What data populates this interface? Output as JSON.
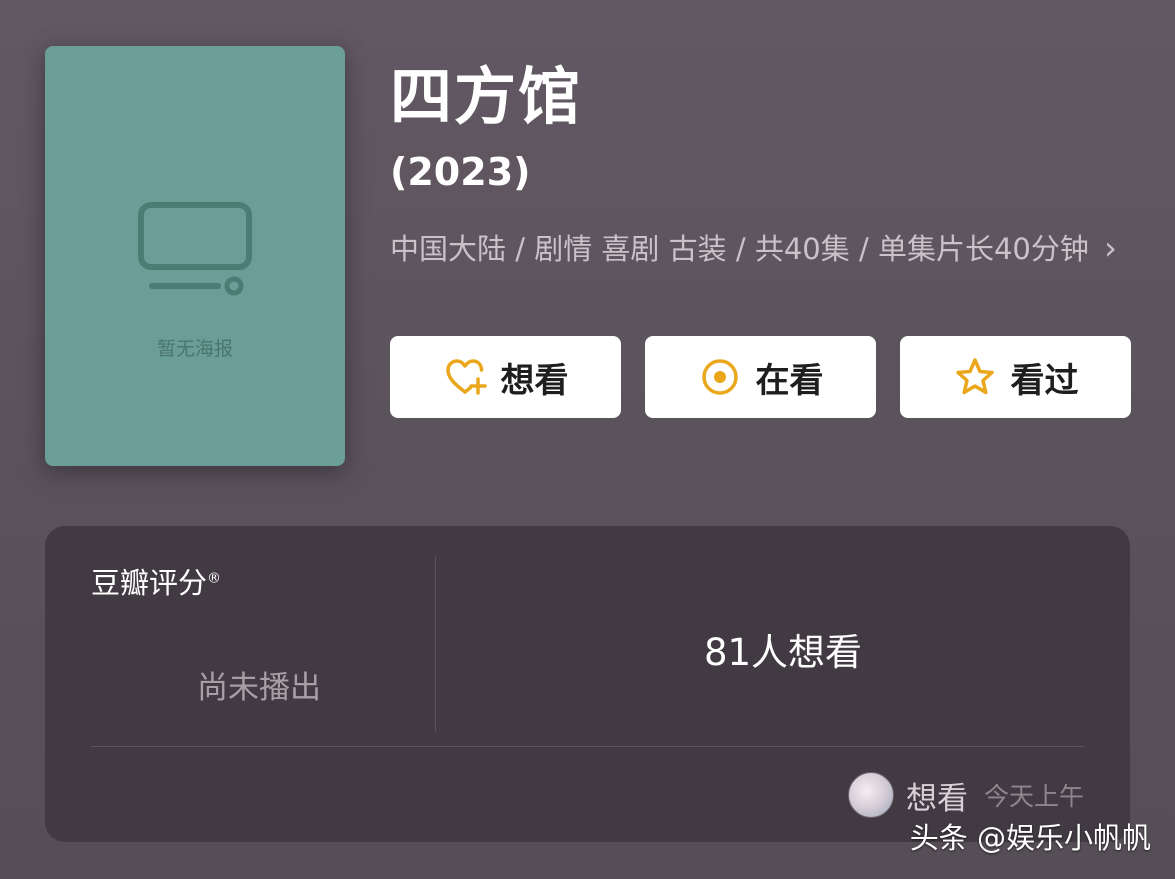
{
  "poster": {
    "placeholder_text": "暂无海报",
    "icon": "tv-icon"
  },
  "title": "四方馆",
  "year": "(2023)",
  "meta": {
    "text": "中国大陆 / 剧情 喜剧 古装 / 共40集 / 单集片长40分钟",
    "chevron": "›"
  },
  "actions": [
    {
      "label": "想看",
      "icon": "heart-plus-icon"
    },
    {
      "label": "在看",
      "icon": "target-circle-icon"
    },
    {
      "label": "看过",
      "icon": "star-outline-icon"
    }
  ],
  "rating": {
    "title": "豆瓣评分",
    "trademark": "®",
    "status": "尚未播出",
    "want_count": "81人想看"
  },
  "activity": {
    "label": "想看",
    "time": "今天上午"
  },
  "watermark": "头条 @娱乐小帆帆",
  "colors": {
    "accent": "#eba71c",
    "poster": "#6a9e96",
    "card": "#413a42",
    "background": "#5d555e"
  }
}
